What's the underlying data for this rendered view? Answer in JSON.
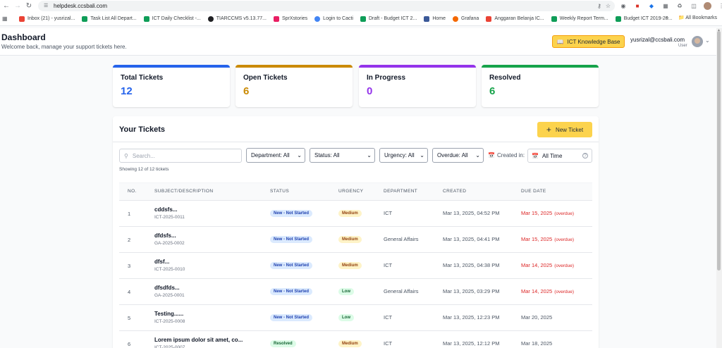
{
  "browser": {
    "url": "helpdesk.ccsbali.com",
    "bookmarks": [
      {
        "label": "Inbox (21) - yusrizal...",
        "color": "#ea4335"
      },
      {
        "label": "Task List All Depart...",
        "color": "#0f9d58"
      },
      {
        "label": "ICT Daily Checklist -...",
        "color": "#0f9d58"
      },
      {
        "label": "TIARCCMS v5.13.77...",
        "color": "#202124"
      },
      {
        "label": "SprXstories",
        "color": "#e91e63"
      },
      {
        "label": "Login to Cacti",
        "color": "#4285f4"
      },
      {
        "label": "Draft - Budget ICT 2...",
        "color": "#0f9d58"
      },
      {
        "label": "Home",
        "color": "#3b5998"
      },
      {
        "label": "Grafana",
        "color": "#f46800"
      },
      {
        "label": "Anggaran Belanja IC...",
        "color": "#ea4335"
      },
      {
        "label": "Weekly Report Term...",
        "color": "#0f9d58"
      },
      {
        "label": "Budget ICT 2019-20...",
        "color": "#0f9d58"
      }
    ],
    "all_bookmarks": "All Bookmarks",
    "overflow": "»"
  },
  "header": {
    "title": "Dashboard",
    "subtitle": "Welcome back, manage your support tickets here.",
    "kb_button": "ICT Knowledge Base",
    "user_email": "yusrizal@ccsbali.com",
    "user_role": "User"
  },
  "stats": [
    {
      "label": "Total Tickets",
      "value": "12",
      "color": "#2563eb"
    },
    {
      "label": "Open Tickets",
      "value": "6",
      "color": "#ca8a04"
    },
    {
      "label": "In Progress",
      "value": "0",
      "color": "#9333ea"
    },
    {
      "label": "Resolved",
      "value": "6",
      "color": "#16a34a"
    }
  ],
  "tickets": {
    "title": "Your Tickets",
    "new_button": "New Ticket",
    "search_placeholder": "Search...",
    "filters": {
      "department": "Department: All",
      "status": "Status: All",
      "urgency": "Urgency: All",
      "overdue": "Overdue: All"
    },
    "created_label": "Created in:",
    "created_value": "All Time",
    "showing": "Showing 12 of 12 tickets",
    "columns": [
      "NO.",
      "SUBJECT/DESCRIPTION",
      "STATUS",
      "URGENCY",
      "DEPARTMENT",
      "CREATED",
      "DUE DATE"
    ],
    "rows": [
      {
        "no": "1",
        "subject": "cddsfs...",
        "code": "ICT-2025-0011",
        "status": "New - Not Started",
        "status_type": "new",
        "urgency": "Medium",
        "urgency_type": "medium",
        "department": "ICT",
        "created": "Mar 13, 2025, 04:52 PM",
        "due": "Mar 15, 2025",
        "overdue": "(overdue)"
      },
      {
        "no": "2",
        "subject": "dfdsfs...",
        "code": "GA-2025-0002",
        "status": "New - Not Started",
        "status_type": "new",
        "urgency": "Medium",
        "urgency_type": "medium",
        "department": "General Affairs",
        "created": "Mar 13, 2025, 04:41 PM",
        "due": "Mar 15, 2025",
        "overdue": "(overdue)"
      },
      {
        "no": "3",
        "subject": "dfsf...",
        "code": "ICT-2025-0010",
        "status": "New - Not Started",
        "status_type": "new",
        "urgency": "Medium",
        "urgency_type": "medium",
        "department": "ICT",
        "created": "Mar 13, 2025, 04:38 PM",
        "due": "Mar 14, 2025",
        "overdue": "(overdue)"
      },
      {
        "no": "4",
        "subject": "dfsdfds...",
        "code": "GA-2025-0001",
        "status": "New - Not Started",
        "status_type": "new",
        "urgency": "Low",
        "urgency_type": "low",
        "department": "General Affairs",
        "created": "Mar 13, 2025, 03:29 PM",
        "due": "Mar 14, 2025",
        "overdue": "(overdue)"
      },
      {
        "no": "5",
        "subject": "Testing......",
        "code": "ICT-2025-0008",
        "status": "New - Not Started",
        "status_type": "new",
        "urgency": "Low",
        "urgency_type": "low",
        "department": "ICT",
        "created": "Mar 13, 2025, 12:23 PM",
        "due": "Mar 20, 2025",
        "overdue": ""
      },
      {
        "no": "6",
        "subject": "Lorem ipsum dolor sit amet, co...",
        "code": "ICT-2025-0007",
        "status": "Resolved",
        "status_type": "resolved",
        "urgency": "Medium",
        "urgency_type": "medium",
        "department": "ICT",
        "created": "Mar 13, 2025, 12:12 PM",
        "due": "Mar 18, 2025",
        "overdue": ""
      }
    ]
  }
}
